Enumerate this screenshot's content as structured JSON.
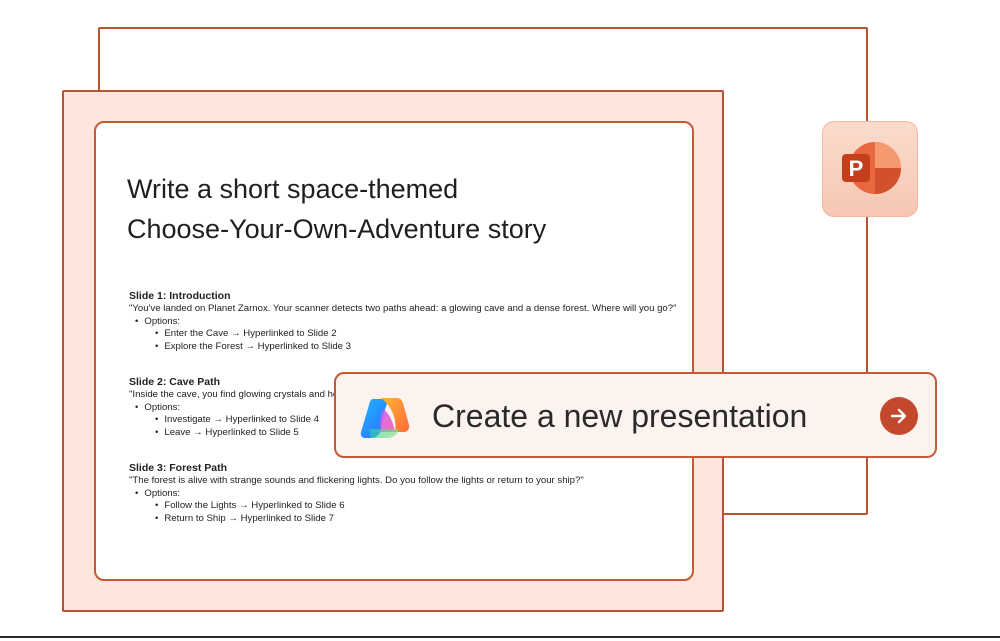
{
  "slide": {
    "title_line1": "Write a short space-themed",
    "title_line2": "Choose-Your-Own-Adventure story",
    "sections": [
      {
        "heading": "Slide 1: Introduction",
        "quote": "\"You've landed on Planet Zarnox. Your scanner detects two paths ahead: a glowing cave and a dense forest. Where will you go?\"",
        "options_label": "Options:",
        "options": [
          "Enter the Cave → Hyperlinked to Slide 2",
          "Explore the Forest → Hyperlinked to Slide 3"
        ]
      },
      {
        "heading": "Slide 2: Cave Path",
        "quote": "\"Inside the cave, you find glowing crystals and hea",
        "options_label": "Options:",
        "options": [
          "Investigate → Hyperlinked to Slide 4",
          "Leave → Hyperlinked to Slide 5"
        ]
      },
      {
        "heading": "Slide 3: Forest Path",
        "quote": "\"The forest is alive with strange sounds and flickering lights. Do you follow the lights or return to your ship?\"",
        "options_label": "Options:",
        "options": [
          "Follow the Lights → Hyperlinked to Slide 6",
          "Return to Ship → Hyperlinked to Slide 7"
        ]
      }
    ]
  },
  "app_icon": {
    "name": "powerpoint-icon",
    "letter": "P",
    "color": "#c43e1c"
  },
  "prompt": {
    "text": "Create a new presentation",
    "icon": "copilot-icon",
    "send_icon": "arrow-right-icon"
  },
  "colors": {
    "frame_border": "#b8532f",
    "frame_fill": "#fde6dd",
    "accent": "#c4492c"
  }
}
